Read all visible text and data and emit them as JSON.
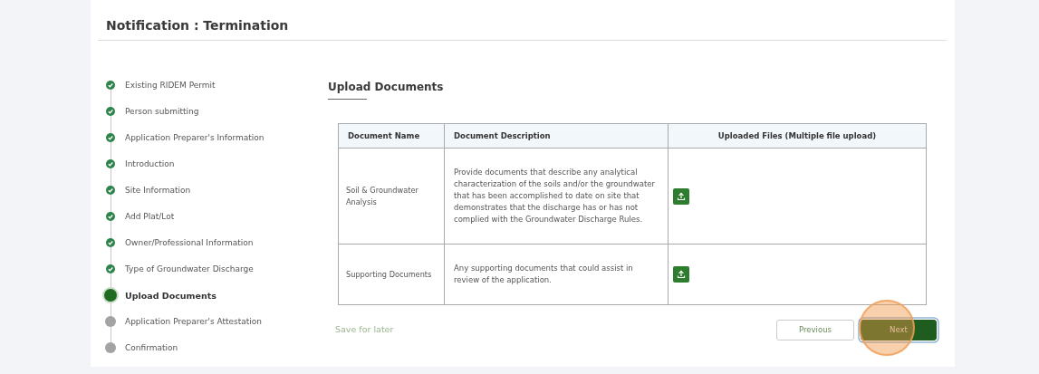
{
  "title": "Notification : Termination",
  "steps": [
    {
      "label": "Existing RIDEM Permit",
      "completed": true,
      "selected": false
    },
    {
      "label": "Person submitting",
      "completed": true,
      "selected": false
    },
    {
      "label": "Application Preparer's Information",
      "completed": true,
      "selected": false
    },
    {
      "label": "Introduction",
      "completed": true,
      "selected": false
    },
    {
      "label": "Site Information",
      "completed": true,
      "selected": false
    },
    {
      "label": "Add Plat/Lot",
      "completed": true,
      "selected": false
    },
    {
      "label": "Owner/Professional Information",
      "completed": true,
      "selected": false
    },
    {
      "label": "Type of Groundwater Discharge",
      "completed": true,
      "selected": false
    },
    {
      "label": "Upload Documents",
      "completed": false,
      "selected": true
    },
    {
      "label": "Application Preparer's Attestation",
      "completed": false,
      "selected": false
    },
    {
      "label": "Confirmation",
      "completed": false,
      "selected": false
    }
  ],
  "section_title": "Upload Documents",
  "table": {
    "columns": [
      "Document Name",
      "Document Description",
      "Uploaded Files (Multiple file upload)"
    ],
    "rows": [
      {
        "name": "Soil & Groundwater Analysis",
        "description": "Provide documents that describe any analytical characterization of the soils and/or the groundwater that has been accomplished to date on site that demonstrates that the discharge has or has not complied with the Groundwater Discharge Rules."
      },
      {
        "name": "Supporting Documents",
        "description": "Any supporting documents that could assist in review of the application."
      }
    ]
  },
  "save_link": "Save for later",
  "buttons": [
    {
      "label": "Previous",
      "kind": "secondary",
      "highlighted": false
    },
    {
      "label": "Next",
      "kind": "primary",
      "highlighted": true
    }
  ]
}
